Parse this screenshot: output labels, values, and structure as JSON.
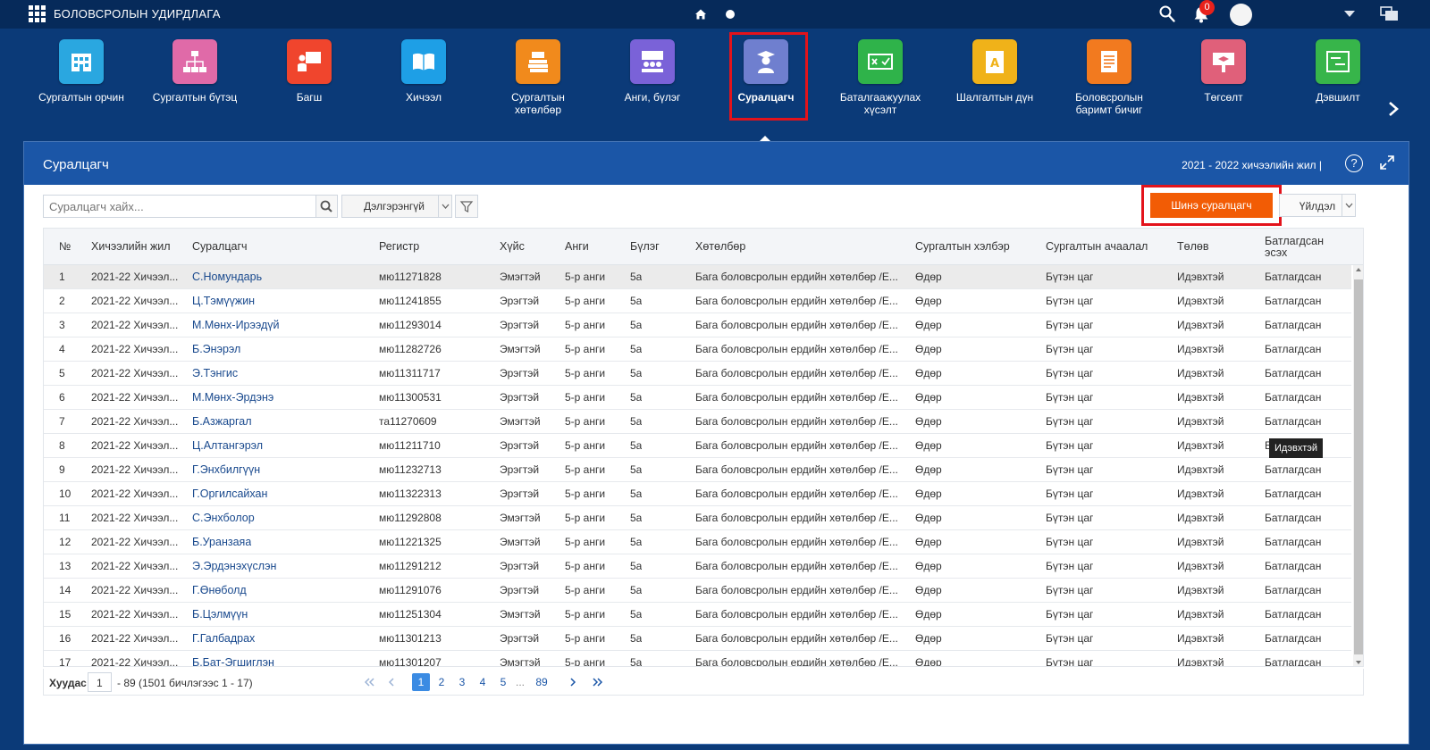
{
  "app": {
    "title": "БОЛОВСРОЛЫН УДИРДЛАГА",
    "notification_count": "0"
  },
  "modules": [
    {
      "label": "Сургалтын орчин",
      "color": "#2aa7e0",
      "icon": "building-icon"
    },
    {
      "label": "Сургалтын бүтэц",
      "color": "#e06aa8",
      "icon": "org-chart-icon"
    },
    {
      "label": "Багш",
      "color": "#f0452d",
      "icon": "teacher-icon"
    },
    {
      "label": "Хичээл",
      "color": "#1e9fe6",
      "icon": "book-icon"
    },
    {
      "label": "Сургалтын хөтөлбөр",
      "color": "#f18a1c",
      "icon": "curriculum-icon"
    },
    {
      "label": "Анги, бүлэг",
      "color": "#7a62d8",
      "icon": "class-group-icon"
    },
    {
      "label": "Суралцагч",
      "color": "#6f7fcf",
      "icon": "graduate-icon"
    },
    {
      "label": "Баталгаажуулах хүсэлт",
      "color": "#2fb34a",
      "icon": "approval-icon"
    },
    {
      "label": "Шалгалтын дүн",
      "color": "#f0b219",
      "icon": "exam-score-icon"
    },
    {
      "label": "Боловсролын баримт бичиг",
      "color": "#f27a1f",
      "icon": "document-icon"
    },
    {
      "label": "Төгсөлт",
      "color": "#e0607a",
      "icon": "graduation-icon"
    },
    {
      "label": "Дэвшилт",
      "color": "#37b54a",
      "icon": "promotion-icon"
    }
  ],
  "panel": {
    "title": "Суралцагч",
    "school_year": "2021 - 2022 хичээлийн жил |",
    "help": "?"
  },
  "toolbar": {
    "search_placeholder": "Суралцагч хайх...",
    "advanced_label": "Дэлгэрэнгүй",
    "new_student_label": "Шинэ суралцагч",
    "action_label": "Үйлдэл"
  },
  "table": {
    "headers": {
      "no": "№",
      "year": "Хичээлийн жил",
      "student": "Суралцагч",
      "register": "Регистр",
      "gender": "Хүйс",
      "class": "Анги",
      "group": "Бүлэг",
      "program": "Хөтөлбөр",
      "study_form": "Сургалтын хэлбэр",
      "study_load": "Сургалтын ачаалал",
      "status": "Төлөв",
      "confirmed": "Батлагдсан эсэх"
    },
    "rows": [
      {
        "no": "1",
        "year": "2021-22 Хичээл...",
        "student": "С.Номундарь",
        "register": "мю11271828",
        "gender": "Эмэгтэй",
        "class": "5-р анги",
        "group": "5а",
        "program": "Бага боловсролын ердийн хөтөлбөр /Е...",
        "study_form": "Өдөр",
        "study_load": "Бүтэн цаг",
        "status": "Идэвхтэй",
        "confirmed": "Батлагдсан"
      },
      {
        "no": "2",
        "year": "2021-22 Хичээл...",
        "student": "Ц.Тэмүүжин",
        "register": "мю11241855",
        "gender": "Эрэгтэй",
        "class": "5-р анги",
        "group": "5а",
        "program": "Бага боловсролын ердийн хөтөлбөр /Е...",
        "study_form": "Өдөр",
        "study_load": "Бүтэн цаг",
        "status": "Идэвхтэй",
        "confirmed": "Батлагдсан"
      },
      {
        "no": "3",
        "year": "2021-22 Хичээл...",
        "student": "М.Мөнх-Ирээдүй",
        "register": "мю11293014",
        "gender": "Эрэгтэй",
        "class": "5-р анги",
        "group": "5а",
        "program": "Бага боловсролын ердийн хөтөлбөр /Е...",
        "study_form": "Өдөр",
        "study_load": "Бүтэн цаг",
        "status": "Идэвхтэй",
        "confirmed": "Батлагдсан"
      },
      {
        "no": "4",
        "year": "2021-22 Хичээл...",
        "student": "Б.Энэрэл",
        "register": "мю11282726",
        "gender": "Эмэгтэй",
        "class": "5-р анги",
        "group": "5а",
        "program": "Бага боловсролын ердийн хөтөлбөр /Е...",
        "study_form": "Өдөр",
        "study_load": "Бүтэн цаг",
        "status": "Идэвхтэй",
        "confirmed": "Батлагдсан"
      },
      {
        "no": "5",
        "year": "2021-22 Хичээл...",
        "student": "Э.Тэнгис",
        "register": "мю11311717",
        "gender": "Эрэгтэй",
        "class": "5-р анги",
        "group": "5а",
        "program": "Бага боловсролын ердийн хөтөлбөр /Е...",
        "study_form": "Өдөр",
        "study_load": "Бүтэн цаг",
        "status": "Идэвхтэй",
        "confirmed": "Батлагдсан"
      },
      {
        "no": "6",
        "year": "2021-22 Хичээл...",
        "student": "М.Мөнх-Эрдэнэ",
        "register": "мю11300531",
        "gender": "Эрэгтэй",
        "class": "5-р анги",
        "group": "5а",
        "program": "Бага боловсролын ердийн хөтөлбөр /Е...",
        "study_form": "Өдөр",
        "study_load": "Бүтэн цаг",
        "status": "Идэвхтэй",
        "confirmed": "Батлагдсан"
      },
      {
        "no": "7",
        "year": "2021-22 Хичээл...",
        "student": "Б.Азжаргал",
        "register": "та11270609",
        "gender": "Эмэгтэй",
        "class": "5-р анги",
        "group": "5а",
        "program": "Бага боловсролын ердийн хөтөлбөр /Е...",
        "study_form": "Өдөр",
        "study_load": "Бүтэн цаг",
        "status": "Идэвхтэй",
        "confirmed": "Батлагдсан"
      },
      {
        "no": "8",
        "year": "2021-22 Хичээл...",
        "student": "Ц.Алтангэрэл",
        "register": "мю11211710",
        "gender": "Эрэгтэй",
        "class": "5-р анги",
        "group": "5а",
        "program": "Бага боловсролын ердийн хөтөлбөр /Е...",
        "study_form": "Өдөр",
        "study_load": "Бүтэн цаг",
        "status": "Идэвхтэй",
        "confirmed": "Батлагдсан"
      },
      {
        "no": "9",
        "year": "2021-22 Хичээл...",
        "student": "Г.Энхбилгүүн",
        "register": "мю11232713",
        "gender": "Эрэгтэй",
        "class": "5-р анги",
        "group": "5а",
        "program": "Бага боловсролын ердийн хөтөлбөр /Е...",
        "study_form": "Өдөр",
        "study_load": "Бүтэн цаг",
        "status": "Идэвхтэй",
        "confirmed": "Батлагдсан"
      },
      {
        "no": "10",
        "year": "2021-22 Хичээл...",
        "student": "Г.Оргилсайхан",
        "register": "мю11322313",
        "gender": "Эрэгтэй",
        "class": "5-р анги",
        "group": "5а",
        "program": "Бага боловсролын ердийн хөтөлбөр /Е...",
        "study_form": "Өдөр",
        "study_load": "Бүтэн цаг",
        "status": "Идэвхтэй",
        "confirmed": "Батлагдсан"
      },
      {
        "no": "11",
        "year": "2021-22 Хичээл...",
        "student": "С.Энхболор",
        "register": "мю11292808",
        "gender": "Эмэгтэй",
        "class": "5-р анги",
        "group": "5а",
        "program": "Бага боловсролын ердийн хөтөлбөр /Е...",
        "study_form": "Өдөр",
        "study_load": "Бүтэн цаг",
        "status": "Идэвхтэй",
        "confirmed": "Батлагдсан"
      },
      {
        "no": "12",
        "year": "2021-22 Хичээл...",
        "student": "Б.Уранзаяа",
        "register": "мю11221325",
        "gender": "Эмэгтэй",
        "class": "5-р анги",
        "group": "5а",
        "program": "Бага боловсролын ердийн хөтөлбөр /Е...",
        "study_form": "Өдөр",
        "study_load": "Бүтэн цаг",
        "status": "Идэвхтэй",
        "confirmed": "Батлагдсан"
      },
      {
        "no": "13",
        "year": "2021-22 Хичээл...",
        "student": "Э.Эрдэнэхүслэн",
        "register": "мю11291212",
        "gender": "Эрэгтэй",
        "class": "5-р анги",
        "group": "5а",
        "program": "Бага боловсролын ердийн хөтөлбөр /Е...",
        "study_form": "Өдөр",
        "study_load": "Бүтэн цаг",
        "status": "Идэвхтэй",
        "confirmed": "Батлагдсан"
      },
      {
        "no": "14",
        "year": "2021-22 Хичээл...",
        "student": "Г.Өнөболд",
        "register": "мю11291076",
        "gender": "Эрэгтэй",
        "class": "5-р анги",
        "group": "5а",
        "program": "Бага боловсролын ердийн хөтөлбөр /Е...",
        "study_form": "Өдөр",
        "study_load": "Бүтэн цаг",
        "status": "Идэвхтэй",
        "confirmed": "Батлагдсан"
      },
      {
        "no": "15",
        "year": "2021-22 Хичээл...",
        "student": "Б.Цэлмүүн",
        "register": "мю11251304",
        "gender": "Эмэгтэй",
        "class": "5-р анги",
        "group": "5а",
        "program": "Бага боловсролын ердийн хөтөлбөр /Е...",
        "study_form": "Өдөр",
        "study_load": "Бүтэн цаг",
        "status": "Идэвхтэй",
        "confirmed": "Батлагдсан"
      },
      {
        "no": "16",
        "year": "2021-22 Хичээл...",
        "student": "Г.Галбадрах",
        "register": "мю11301213",
        "gender": "Эрэгтэй",
        "class": "5-р анги",
        "group": "5а",
        "program": "Бага боловсролын ердийн хөтөлбөр /Е...",
        "study_form": "Өдөр",
        "study_load": "Бүтэн цаг",
        "status": "Идэвхтэй",
        "confirmed": "Батлагдсан"
      },
      {
        "no": "17",
        "year": "2021-22 Хичээл...",
        "student": "Б.Бат-Эгшиглэн",
        "register": "мю11301207",
        "gender": "Эмэгтэй",
        "class": "5-р анги",
        "group": "5а",
        "program": "Бага боловсролын ердийн хөтөлбөр /Е...",
        "study_form": "Өдөр",
        "study_load": "Бүтэн цаг",
        "status": "Идэвхтэй",
        "confirmed": "Батлагдсан"
      }
    ],
    "tooltip": "Идэвхтэй"
  },
  "pager": {
    "label": "Хуудас",
    "current_page": "1",
    "info": "- 89  (1501 бичлэгээс 1 - 17)",
    "pages": [
      "1",
      "2",
      "3",
      "4",
      "5",
      "...",
      "89"
    ]
  },
  "colors": {
    "background": "#0b3a78",
    "topbar": "#062a5a",
    "panel_header": "#1b56a7",
    "accent_orange": "#f25c05",
    "highlight_red": "#e3131b",
    "link_blue": "#1a4a8e"
  }
}
